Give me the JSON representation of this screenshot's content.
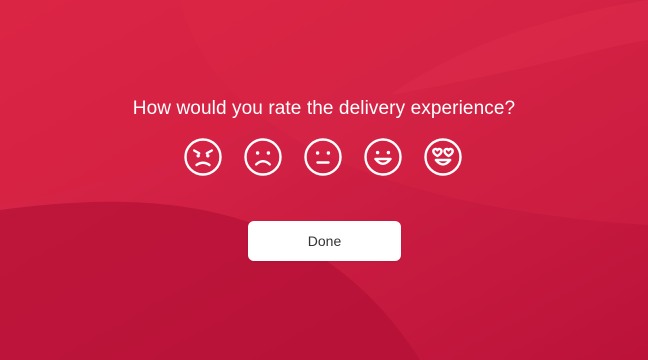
{
  "survey": {
    "question": "How would you rate the delivery experience?",
    "ratings": [
      {
        "icon": "angry-face-icon"
      },
      {
        "icon": "sad-face-icon"
      },
      {
        "icon": "neutral-face-icon"
      },
      {
        "icon": "smiling-face-icon"
      },
      {
        "icon": "heart-eyes-face-icon"
      }
    ],
    "done_label": "Done"
  },
  "theme": {
    "background": "#d91f45",
    "accent_dark": "#a90f37",
    "text_color": "#ffffff",
    "button_bg": "#ffffff",
    "button_text": "#333333"
  }
}
